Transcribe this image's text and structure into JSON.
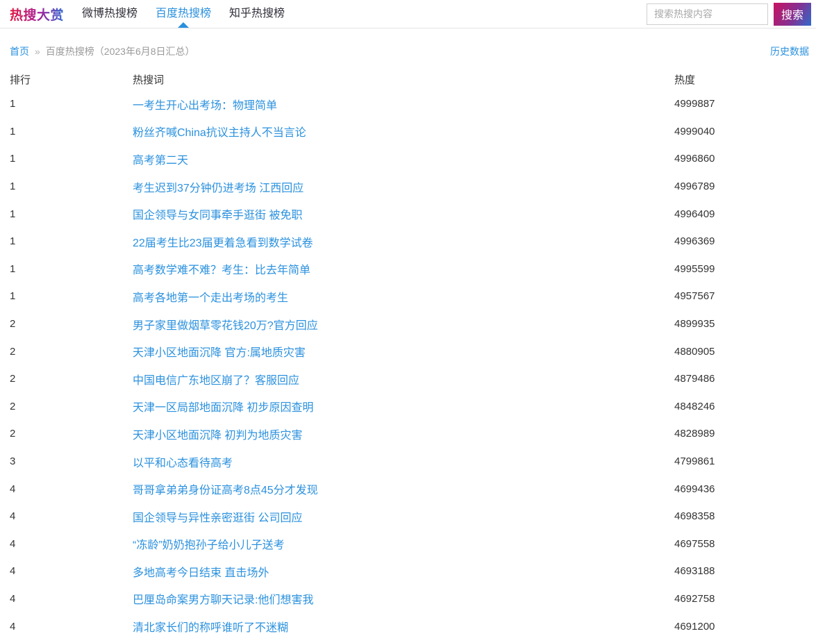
{
  "nav": {
    "logo": "热搜大赏",
    "items": [
      {
        "label": "微博热搜榜",
        "active": false
      },
      {
        "label": "百度热搜榜",
        "active": true
      },
      {
        "label": "知乎热搜榜",
        "active": false
      }
    ],
    "search": {
      "placeholder": "搜索热搜内容",
      "button_label": "搜索"
    }
  },
  "breadcrumb": {
    "home": "首页",
    "separator": "»",
    "current": "百度热搜榜（2023年6月8日汇总）",
    "history_link": "历史数据"
  },
  "table": {
    "headers": {
      "rank": "排行",
      "keyword": "热搜词",
      "heat": "热度"
    },
    "rows": [
      {
        "rank": "1",
        "keyword": "一考生开心出考场：物理简单",
        "heat": "4999887"
      },
      {
        "rank": "1",
        "keyword": "粉丝齐喊China抗议主持人不当言论",
        "heat": "4999040"
      },
      {
        "rank": "1",
        "keyword": "高考第二天",
        "heat": "4996860"
      },
      {
        "rank": "1",
        "keyword": "考生迟到37分钟仍进考场 江西回应",
        "heat": "4996789"
      },
      {
        "rank": "1",
        "keyword": "国企领导与女同事牵手逛街 被免职",
        "heat": "4996409"
      },
      {
        "rank": "1",
        "keyword": "22届考生比23届更着急看到数学试卷",
        "heat": "4996369"
      },
      {
        "rank": "1",
        "keyword": "高考数学难不难？考生：比去年简单",
        "heat": "4995599"
      },
      {
        "rank": "1",
        "keyword": "高考各地第一个走出考场的考生",
        "heat": "4957567"
      },
      {
        "rank": "2",
        "keyword": "男子家里做烟草零花钱20万?官方回应",
        "heat": "4899935"
      },
      {
        "rank": "2",
        "keyword": "天津小区地面沉降 官方:属地质灾害",
        "heat": "4880905"
      },
      {
        "rank": "2",
        "keyword": "中国电信广东地区崩了？客服回应",
        "heat": "4879486"
      },
      {
        "rank": "2",
        "keyword": "天津一区局部地面沉降 初步原因查明",
        "heat": "4848246"
      },
      {
        "rank": "2",
        "keyword": "天津小区地面沉降 初判为地质灾害",
        "heat": "4828989"
      },
      {
        "rank": "3",
        "keyword": "以平和心态看待高考",
        "heat": "4799861"
      },
      {
        "rank": "4",
        "keyword": "哥哥拿弟弟身份证高考8点45分才发现",
        "heat": "4699436"
      },
      {
        "rank": "4",
        "keyword": "国企领导与异性亲密逛街 公司回应",
        "heat": "4698358"
      },
      {
        "rank": "4",
        "keyword": "“冻龄”奶奶抱孙子给小儿子送考",
        "heat": "4697558"
      },
      {
        "rank": "4",
        "keyword": "多地高考今日结束 直击场外",
        "heat": "4693188"
      },
      {
        "rank": "4",
        "keyword": "巴厘岛命案男方聊天记录:他们想害我",
        "heat": "4692758"
      },
      {
        "rank": "4",
        "keyword": "清北家长们的称呼谁听了不迷糊",
        "heat": "4691200"
      }
    ]
  },
  "colors": {
    "accent_blue": "#2b91de",
    "logo_gradient": [
      "#e3173f",
      "#a5209c",
      "#2e6ad2"
    ],
    "button_gradient": [
      "#c8125f",
      "#2e6bcc"
    ],
    "text_dark": "#333333",
    "text_gray": "#999999",
    "border_gray": "#e4e4e4"
  }
}
